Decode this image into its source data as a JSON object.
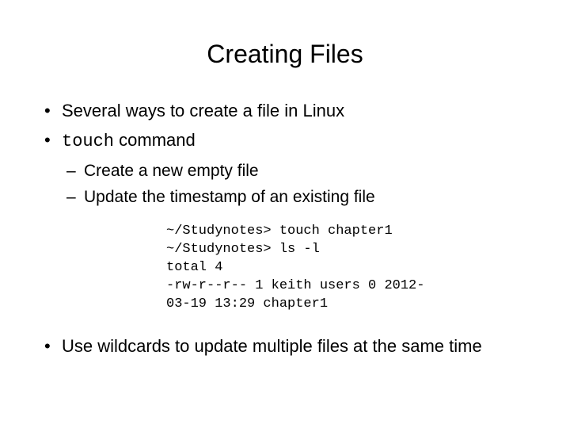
{
  "title": "Creating Files",
  "b1": "Several ways to create a file in Linux",
  "b2_cmd": "touch",
  "b2_rest": " command",
  "b2a": "Create a new empty file",
  "b2b": "Update the timestamp of an existing file",
  "code": "~/Studynotes> touch chapter1\n~/Studynotes> ls -l\ntotal 4\n-rw-r--r-- 1 keith users 0 2012-\n03-19 13:29 chapter1",
  "b3": "Use wildcards to update multiple files at the same time"
}
